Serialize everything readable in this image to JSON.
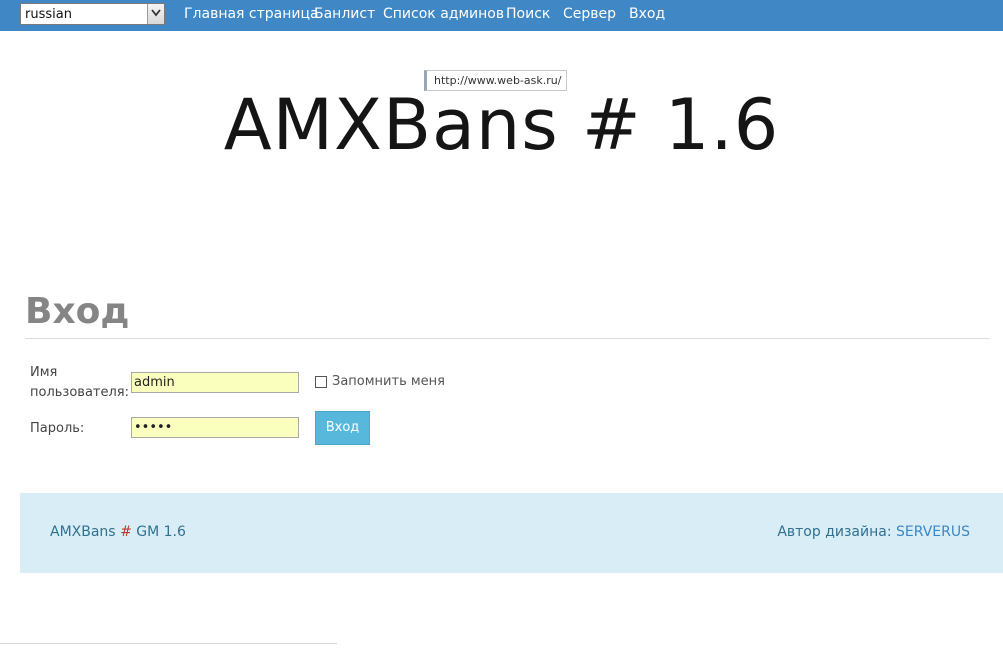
{
  "header": {
    "language_select": {
      "value": "russian"
    },
    "nav": [
      {
        "label": "Главная страница"
      },
      {
        "label": "Банлист"
      },
      {
        "label": "Список админов"
      },
      {
        "label": "Поиск"
      },
      {
        "label": "Сервер"
      },
      {
        "label": "Вход"
      }
    ],
    "colors": {
      "bar": "#3f88c5"
    }
  },
  "tooltip": {
    "text": "http://www.web-ask.ru/"
  },
  "logo": {
    "title": "AMXBans # 1.6"
  },
  "login": {
    "title": "Вход",
    "username_label": "Имя пользователя:",
    "username_value": "admin",
    "remember_label": "Запомнить меня",
    "password_label": "Пароль:",
    "password_value": "•••••",
    "submit_label": "Вход"
  },
  "footer": {
    "left_text_a": "AMXBans",
    "left_hash": "#",
    "left_text_b": "GM 1.6",
    "author_label": "Автор дизайна:",
    "author_link": "SERVERUS"
  }
}
